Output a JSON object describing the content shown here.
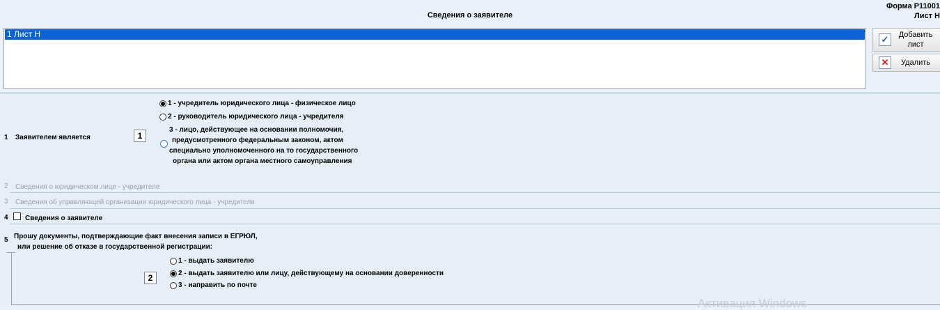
{
  "header": {
    "title": "Сведения о заявителе",
    "form_code": "Форма Р11001",
    "sheet": "Лист Н"
  },
  "list": {
    "selected_item": "1 Лист Н"
  },
  "buttons": {
    "add_label": "Добавить лист",
    "delete_label": "Удалить"
  },
  "section1": {
    "number": "1",
    "label": "Заявителем является",
    "value": "1",
    "options": [
      {
        "text": "1 - учредитель юридического лица - физическое лицо",
        "selected": true
      },
      {
        "text": "2 - руководитель юридического лица - учредителя",
        "selected": false
      },
      {
        "text_lines": [
          "3 - лицо, действующее на основании полномочия,",
          "предусмотренного федеральным законом, актом",
          "специально уполномоченного на то государственного",
          "органа или актом органа местного самоуправления"
        ],
        "selected": false
      }
    ]
  },
  "section2": {
    "number": "2",
    "label": "Сведения о юридическом лице - учредителе"
  },
  "section3": {
    "number": "3",
    "label": "Сведения об управляющей организации юридического лица - учредителя"
  },
  "section4": {
    "number": "4",
    "label": "Сведения о заявителе",
    "checked": false
  },
  "section5": {
    "number": "5",
    "label_lines": [
      "Прошу документы, подтверждающие факт внесения записи в ЕГРЮЛ,",
      "или решение об отказе в государственной регистрации:"
    ],
    "value": "2",
    "options": [
      {
        "text": "1 - выдать заявителю",
        "selected": false
      },
      {
        "text": "2 - выдать заявителю или лицу, действующему на основании доверенности",
        "selected": true
      },
      {
        "text": "3 - направить по почте",
        "selected": false
      }
    ]
  },
  "watermark": "Активация Windows",
  "colors": {
    "selection": "#0a64d8",
    "background": "#eaf1fb"
  }
}
